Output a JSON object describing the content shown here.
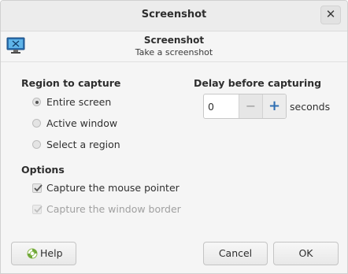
{
  "window": {
    "title": "Screenshot",
    "close_glyph": "✕"
  },
  "header": {
    "title": "Screenshot",
    "subtitle": "Take a screenshot",
    "icon": "screenshot-monitor-icon"
  },
  "region": {
    "title": "Region to capture",
    "options": [
      {
        "label": "Entire screen",
        "selected": true
      },
      {
        "label": "Active window",
        "selected": false
      },
      {
        "label": "Select a region",
        "selected": false
      }
    ]
  },
  "delay": {
    "title": "Delay before capturing",
    "value": "0",
    "minus_glyph": "−",
    "plus_glyph": "+",
    "unit_label": "seconds"
  },
  "options": {
    "title": "Options",
    "items": [
      {
        "label": "Capture the mouse pointer",
        "checked": true,
        "enabled": true
      },
      {
        "label": "Capture the window border",
        "checked": true,
        "enabled": false
      }
    ]
  },
  "buttons": {
    "help": "Help",
    "cancel": "Cancel",
    "ok": "OK"
  },
  "colors": {
    "accent": "#2f6fb3",
    "disabled_text": "#a0a0a0"
  }
}
